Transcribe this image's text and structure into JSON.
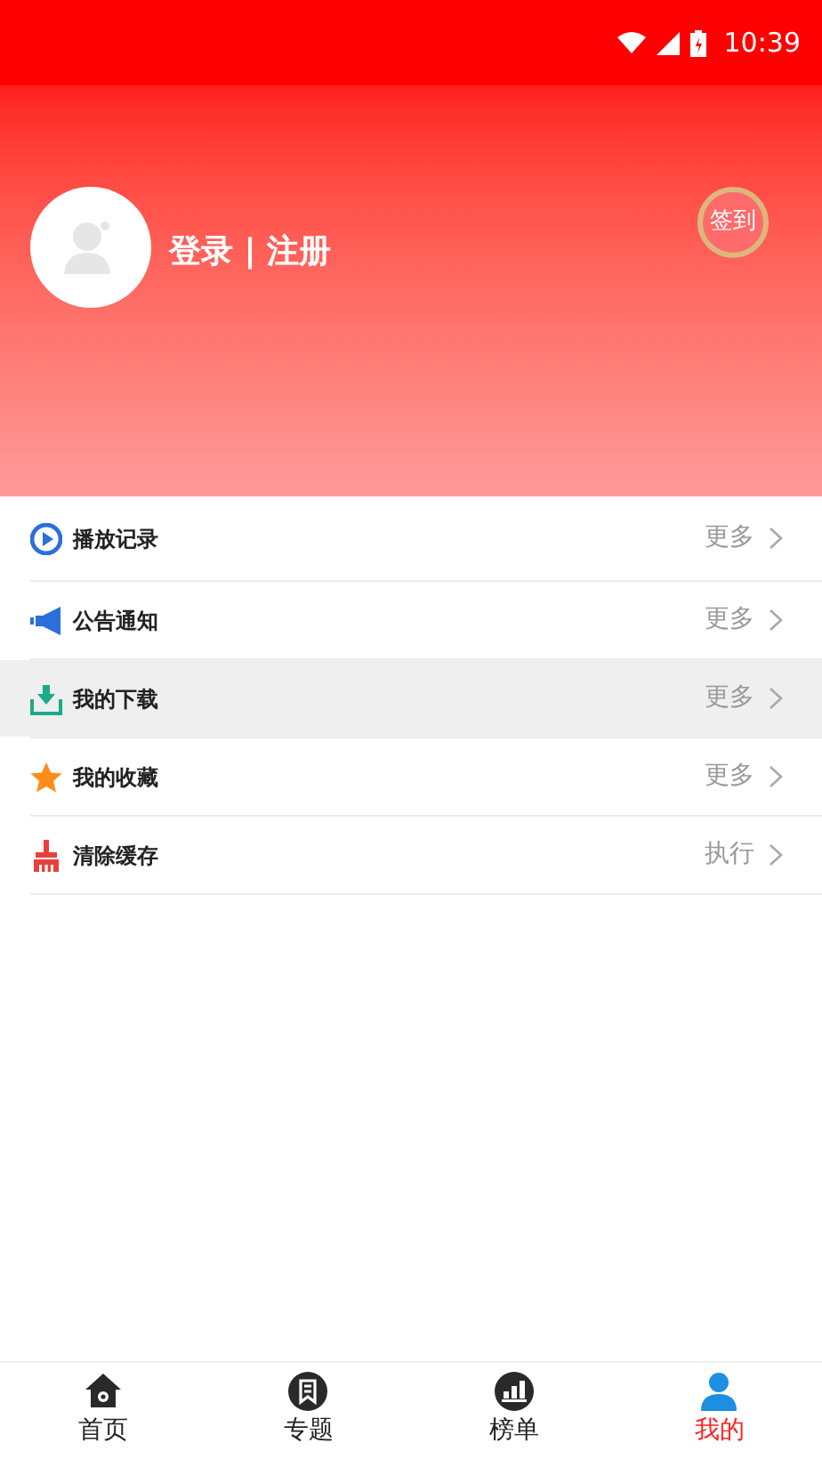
{
  "status_bar": {
    "time": "10:39"
  },
  "profile": {
    "login_text": "登录 | 注册",
    "checkin_button": "签到"
  },
  "menu": [
    {
      "kind": "play",
      "label": "播放记录",
      "action": "更多",
      "selected": false
    },
    {
      "kind": "megaphone",
      "label": "公告通知",
      "action": "更多",
      "selected": false
    },
    {
      "kind": "download",
      "label": "我的下载",
      "action": "更多",
      "selected": true
    },
    {
      "kind": "star",
      "label": "我的收藏",
      "action": "更多",
      "selected": false
    },
    {
      "kind": "broom",
      "label": "清除缓存",
      "action": "执行",
      "selected": false
    }
  ],
  "tabs": [
    {
      "kind": "home",
      "label": "首页",
      "selected": false
    },
    {
      "kind": "topic",
      "label": "专题",
      "selected": false
    },
    {
      "kind": "chart",
      "label": "榜单",
      "selected": false
    },
    {
      "kind": "user",
      "label": "我的",
      "selected": true
    }
  ]
}
